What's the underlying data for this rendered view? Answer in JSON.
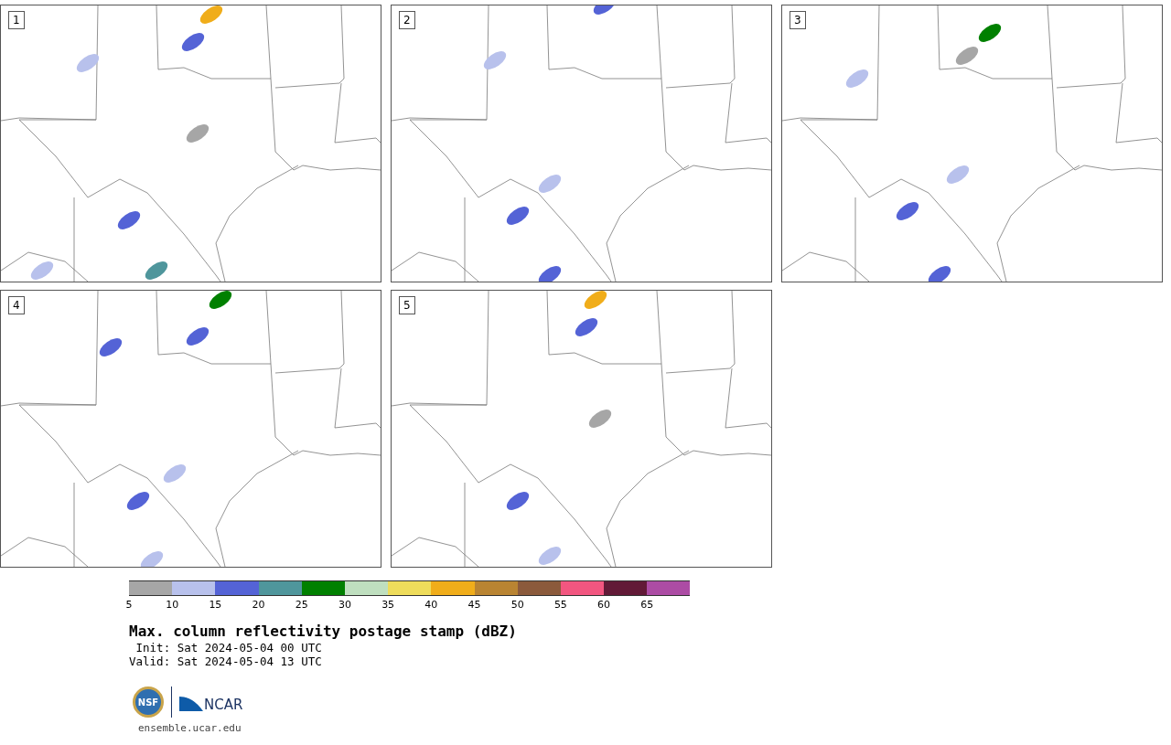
{
  "panels": [
    {
      "label": "1"
    },
    {
      "label": "2"
    },
    {
      "label": "3"
    },
    {
      "label": "4"
    },
    {
      "label": "5"
    }
  ],
  "colorbar": [
    {
      "label": "5",
      "color": "#a6a6a6"
    },
    {
      "label": "10",
      "color": "#b8c1ec"
    },
    {
      "label": "15",
      "color": "#5463d6"
    },
    {
      "label": "20",
      "color": "#4f969c"
    },
    {
      "label": "25",
      "color": "#008000"
    },
    {
      "label": "30",
      "color": "#bfdfbf"
    },
    {
      "label": "35",
      "color": "#eedc5b"
    },
    {
      "label": "40",
      "color": "#f0ad1a"
    },
    {
      "label": "45",
      "color": "#b98432"
    },
    {
      "label": "50",
      "color": "#8b5a3c"
    },
    {
      "label": "55",
      "color": "#f25680"
    },
    {
      "label": "60",
      "color": "#621a37"
    },
    {
      "label": "65",
      "color": "#ac4ca4"
    }
  ],
  "title": "Max. column reflectivity postage stamp (dBZ)",
  "init": " Init: Sat 2024-05-04 00 UTC",
  "valid": "Valid: Sat 2024-05-04 13 UTC",
  "logos": {
    "nsf": "NSF",
    "ncar": "NCAR"
  },
  "url": "ensemble.ucar.edu"
}
